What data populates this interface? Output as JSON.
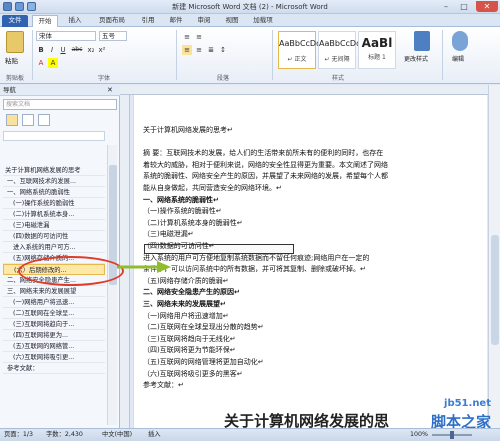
{
  "window": {
    "title": "新建 Microsoft Word 文档 (2) - Microsoft Word",
    "min": "–",
    "max": "□",
    "close": "✕"
  },
  "tabs": [
    "文件",
    "开始",
    "插入",
    "页面布局",
    "引用",
    "邮件",
    "审阅",
    "视图",
    "加载项"
  ],
  "ribbon": {
    "paste": "粘贴",
    "clipboard": "剪贴板",
    "font_name": "宋体",
    "font_size": "五号",
    "font_group": "字体",
    "paragraph_group": "段落",
    "styles": [
      {
        "sample": "AaBbCcDd",
        "name": "↵ 正文"
      },
      {
        "sample": "AaBbCcDd",
        "name": "↵ 无间隔"
      },
      {
        "sample": "AaBl",
        "name": "标题 1"
      }
    ],
    "styles_group": "样式",
    "change_styles": "更改样式",
    "editing": "编辑",
    "font_buttons": [
      "B",
      "I",
      "U",
      "abc",
      "x₂",
      "x²",
      "A",
      "A"
    ],
    "para_buttons": [
      "≡",
      "≡",
      "≡",
      "≡",
      "≣",
      "↕"
    ]
  },
  "nav": {
    "title": "导航",
    "search_placeholder": "搜索文档",
    "items": [
      "关于计算机网络发展的思考",
      "一、互联网技术的发展...",
      "一、网络系统的脆弱性",
      "(一)操作系统的脆弱性",
      "(二)计算机系统本身...",
      "(三)电磁泄漏",
      "(四)数据的可访问性",
      "进入系统的用户可方...",
      "(五)网络存储介质的...",
      "(六）后期修改的...",
      "二、网络安全隐患产生...",
      "三、网络未来的发展展望",
      "(一)网络用户将迅速...",
      "(二)互联网在全球呈...",
      "(三)互联网将趋向于...",
      "(四)互联网将更为...",
      "(五)互联网的网络管...",
      "(六)互联网将吸引更...",
      "参考文献："
    ],
    "highlight_index": 9
  },
  "document": {
    "lines": [
      {
        "t": "关于计算机网络发展的思考↵",
        "b": false
      },
      {
        "t": "",
        "b": false
      },
      {
        "t": "摘  要：互联网技术的发展，给人们的生活带来前所未有的便利的同时，也存在",
        "b": false
      },
      {
        "t": "着较大的威胁，相对于便利来说，网络的安全性显得更为重要。本文阐述了网络",
        "b": false
      },
      {
        "t": "系统的脆弱性、网络安全产生的原因，并展望了未来网络的发展，希望每个人都",
        "b": false
      },
      {
        "t": "能从自身做起，共同营造安全的网络环境。↵",
        "b": false
      },
      {
        "t": "一、网络系统的脆弱性↵",
        "b": true
      },
      {
        "t": "（一)操作系统的脆弱性↵",
        "b": false
      },
      {
        "t": "（二)计算机系统本身的脆弱性↵",
        "b": false
      },
      {
        "t": "（三)电磁泄漏↵",
        "b": false
      },
      {
        "t": "（四)数据的可访问性↵",
        "b": false
      },
      {
        "t": "进入系统的用户可方便地复制系统数据而不留任何痕迹;网络用户在一定的",
        "b": false
      },
      {
        "t": "条件下，可以访问系统中的所有数据，并可将其复制、删除或破坏掉。↵",
        "b": false
      },
      {
        "t": "（五)网络存储介质的脆弱↵",
        "b": false
      },
      {
        "t": "二、网络安全隐患产生的原因↵",
        "b": true
      },
      {
        "t": "三、网络未来的发展展望↵",
        "b": true
      },
      {
        "t": "（一)网络用户将迅速增加↵",
        "b": false
      },
      {
        "t": "（二)互联网在全球呈现出分散的趋势↵",
        "b": false
      },
      {
        "t": "（三)互联网将趋向于无线化↵",
        "b": false
      },
      {
        "t": "（四)互联网将更为节能环保↵",
        "b": false
      },
      {
        "t": "（五)互联网的网络管理将更加自动化↵",
        "b": false
      },
      {
        "t": "（六)互联网将吸引更多的黑客↵",
        "b": false
      },
      {
        "t": "参考文献：↵",
        "b": false
      }
    ],
    "next_title": "关于计算机网络发展的思"
  },
  "status": {
    "page": "页面：1/3",
    "words": "字数：2,430",
    "lang": "中文(中国)",
    "mode": "插入",
    "zoom": "100%"
  },
  "watermark": {
    "site": "jb51.net",
    "name": "脚本之家"
  },
  "colors": {
    "file_tab": "#2f62b0",
    "highlight": "#fde8a8",
    "annotation": "#e03a2a",
    "arrow": "#8fbd2e"
  }
}
